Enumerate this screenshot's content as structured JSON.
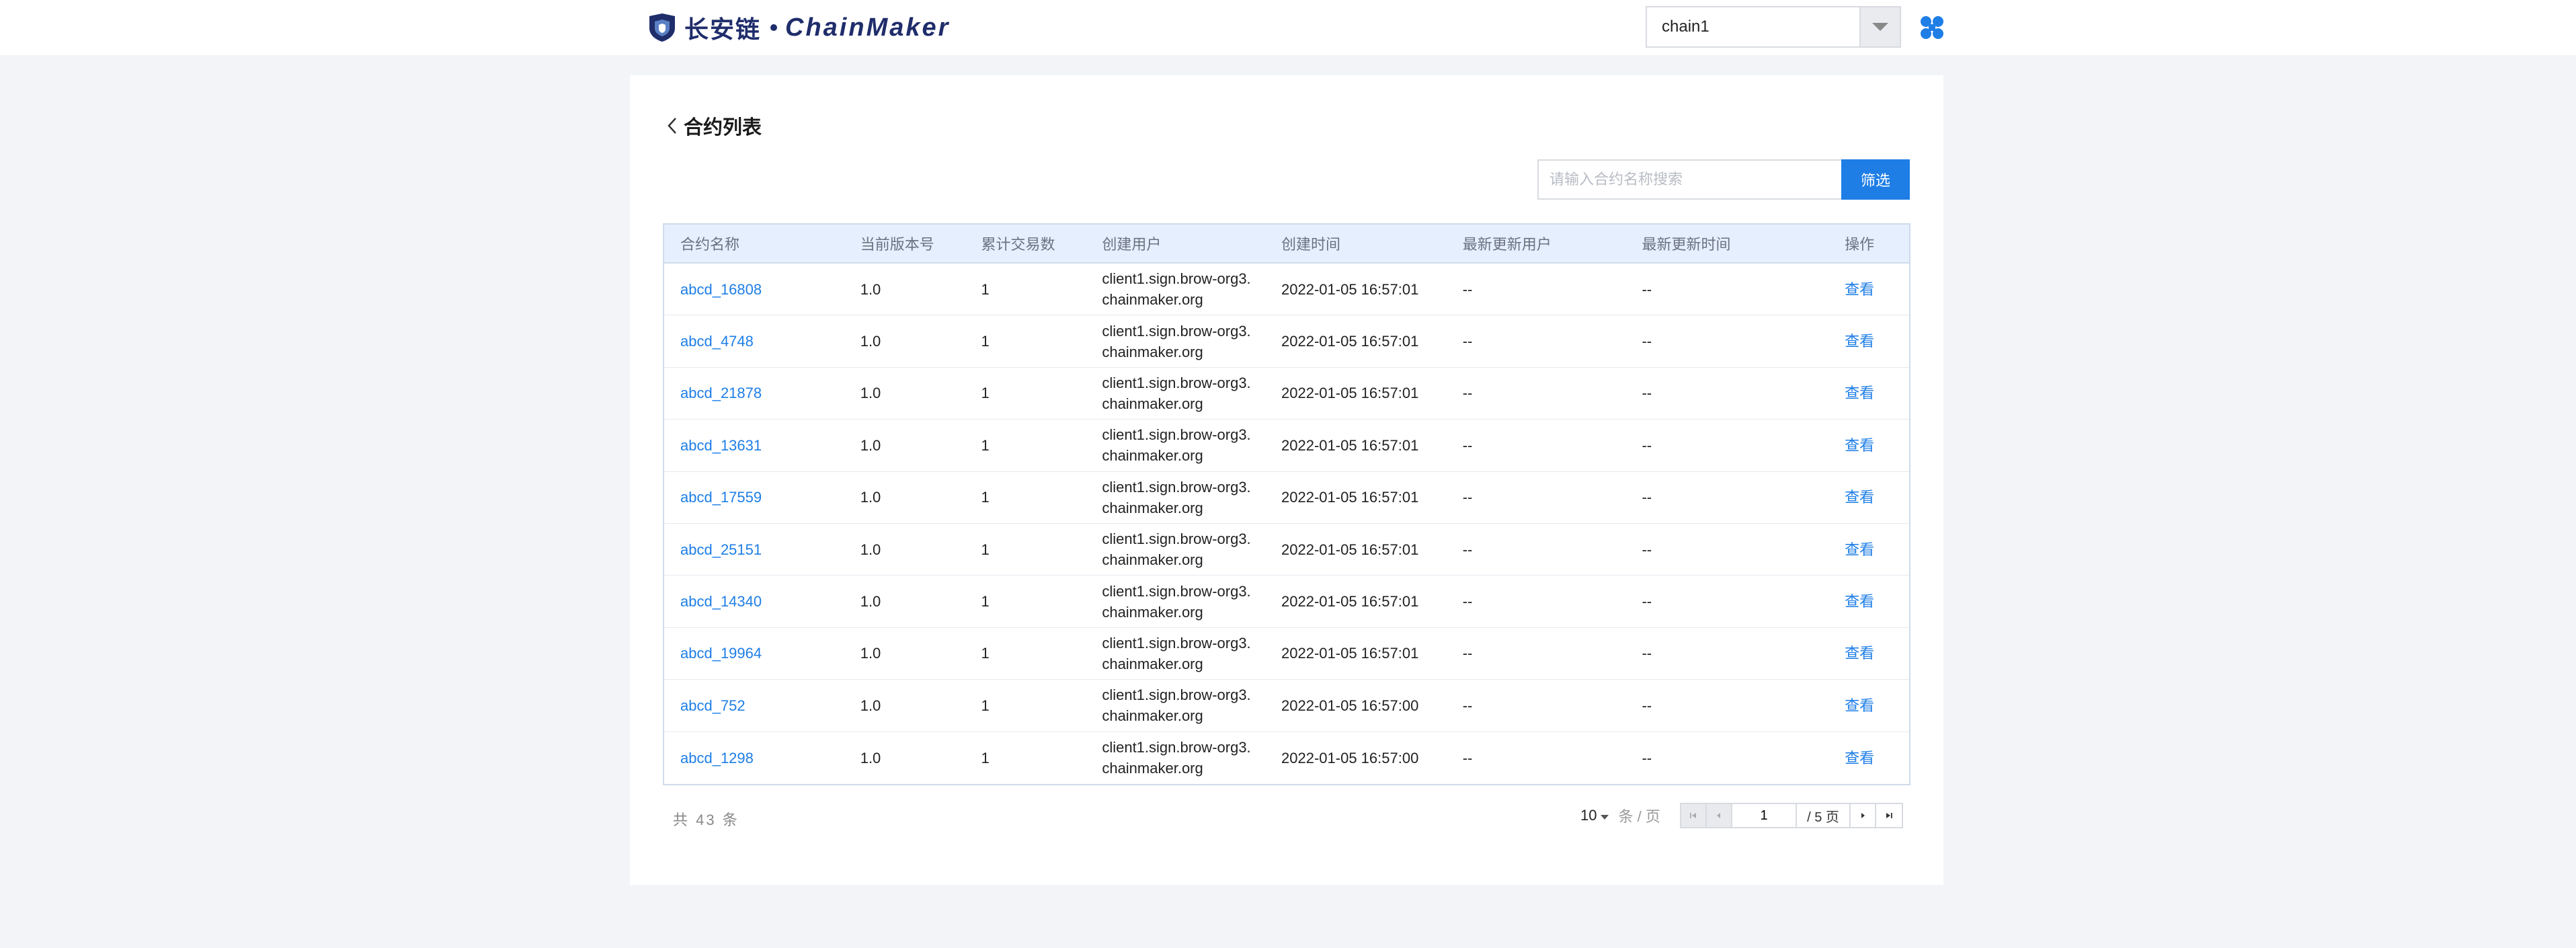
{
  "header": {
    "logo_cn": "长安链",
    "logo_en": "ChainMaker",
    "chain_selected": "chain1"
  },
  "page": {
    "title": "合约列表",
    "search_placeholder": "请输入合约名称搜索",
    "filter_label": "筛选"
  },
  "table": {
    "columns": [
      "合约名称",
      "当前版本号",
      "累计交易数",
      "创建用户",
      "创建时间",
      "最新更新用户",
      "最新更新时间",
      "操作"
    ],
    "rows": [
      {
        "name": "abcd_16808",
        "version": "1.0",
        "tx_count": "1",
        "creator": "client1.sign.brow-org3.chainmaker.org",
        "created_at": "2022-01-05 16:57:01",
        "updater": "--",
        "updated_at": "--",
        "action": "查看"
      },
      {
        "name": "abcd_4748",
        "version": "1.0",
        "tx_count": "1",
        "creator": "client1.sign.brow-org3.chainmaker.org",
        "created_at": "2022-01-05 16:57:01",
        "updater": "--",
        "updated_at": "--",
        "action": "查看"
      },
      {
        "name": "abcd_21878",
        "version": "1.0",
        "tx_count": "1",
        "creator": "client1.sign.brow-org3.chainmaker.org",
        "created_at": "2022-01-05 16:57:01",
        "updater": "--",
        "updated_at": "--",
        "action": "查看"
      },
      {
        "name": "abcd_13631",
        "version": "1.0",
        "tx_count": "1",
        "creator": "client1.sign.brow-org3.chainmaker.org",
        "created_at": "2022-01-05 16:57:01",
        "updater": "--",
        "updated_at": "--",
        "action": "查看"
      },
      {
        "name": "abcd_17559",
        "version": "1.0",
        "tx_count": "1",
        "creator": "client1.sign.brow-org3.chainmaker.org",
        "created_at": "2022-01-05 16:57:01",
        "updater": "--",
        "updated_at": "--",
        "action": "查看"
      },
      {
        "name": "abcd_25151",
        "version": "1.0",
        "tx_count": "1",
        "creator": "client1.sign.brow-org3.chainmaker.org",
        "created_at": "2022-01-05 16:57:01",
        "updater": "--",
        "updated_at": "--",
        "action": "查看"
      },
      {
        "name": "abcd_14340",
        "version": "1.0",
        "tx_count": "1",
        "creator": "client1.sign.brow-org3.chainmaker.org",
        "created_at": "2022-01-05 16:57:01",
        "updater": "--",
        "updated_at": "--",
        "action": "查看"
      },
      {
        "name": "abcd_19964",
        "version": "1.0",
        "tx_count": "1",
        "creator": "client1.sign.brow-org3.chainmaker.org",
        "created_at": "2022-01-05 16:57:01",
        "updater": "--",
        "updated_at": "--",
        "action": "查看"
      },
      {
        "name": "abcd_752",
        "version": "1.0",
        "tx_count": "1",
        "creator": "client1.sign.brow-org3.chainmaker.org",
        "created_at": "2022-01-05 16:57:00",
        "updater": "--",
        "updated_at": "--",
        "action": "查看"
      },
      {
        "name": "abcd_1298",
        "version": "1.0",
        "tx_count": "1",
        "creator": "client1.sign.brow-org3.chainmaker.org",
        "created_at": "2022-01-05 16:57:00",
        "updater": "--",
        "updated_at": "--",
        "action": "查看"
      }
    ]
  },
  "footer": {
    "total_text": "共 43 条",
    "page_size": "10",
    "page_size_unit": "条 / 页",
    "current_page": "1",
    "total_pages_text": "/ 5 页"
  },
  "icons": {
    "logo": "chainmaker-logo-icon",
    "dropdown": "chevron-down-icon",
    "apps": "apps-grid-icon",
    "back": "chevron-left-icon",
    "first": "first-page-icon",
    "prev": "prev-page-icon",
    "next": "next-page-icon",
    "last": "last-page-icon"
  },
  "colors": {
    "brand": "#1f2d6b",
    "accent": "#1e7ee6",
    "table_header_bg": "#e5effd",
    "page_bg": "#f2f4f8"
  }
}
